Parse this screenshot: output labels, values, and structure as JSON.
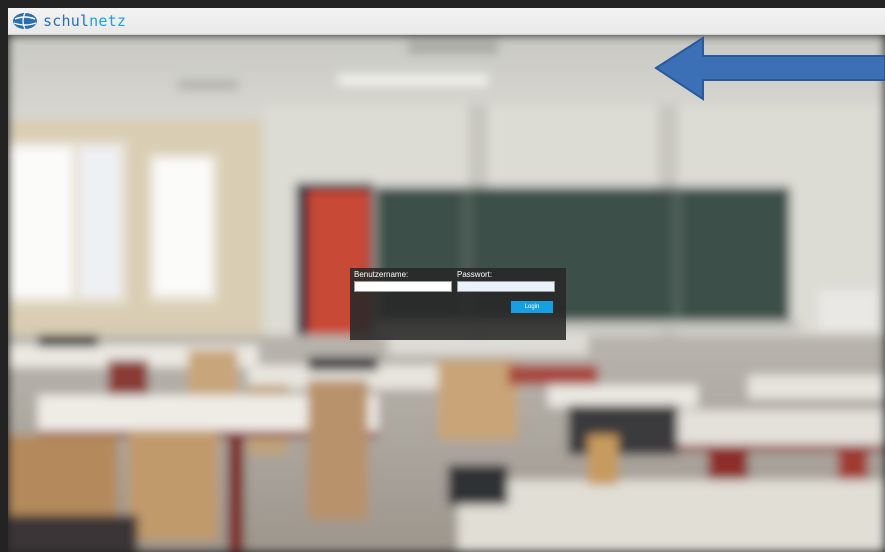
{
  "header": {
    "brand_prefix": "schul",
    "brand_suffix": "netz",
    "logo_icon": "globe-logo-icon",
    "brand_color": "#2a6fb0",
    "brand_accent": "#1ea1d9"
  },
  "login": {
    "username_label": "Benutzername:",
    "username_value": "",
    "password_label": "Passwort:",
    "password_value": "",
    "submit_label": "Login",
    "button_color": "#16a0e2"
  },
  "annotation": {
    "arrow_icon": "left-arrow-icon",
    "arrow_color": "#3b6fb6"
  }
}
